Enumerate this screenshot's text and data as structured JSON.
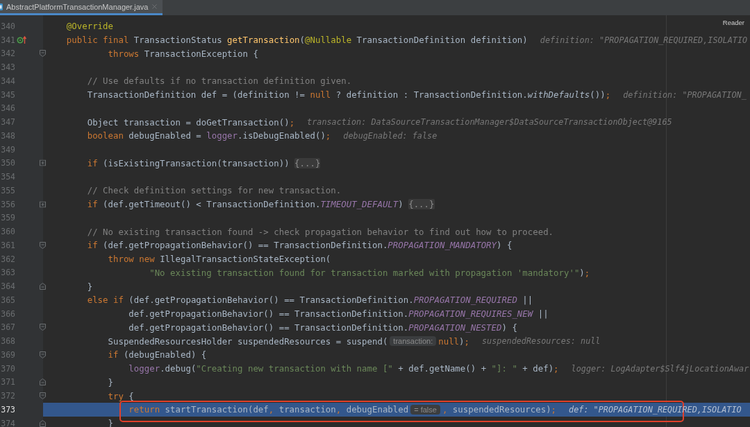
{
  "tabs": [
    {
      "label": "AbstractPlatformTransactionManager.java",
      "selected": true
    }
  ],
  "reader_mode": "Reader",
  "lines": [
    {
      "number": "340",
      "segments": [
        {
          "kind": "code",
          "tokens": [
            {
              "kind": "ann",
              "t": "    @Override"
            }
          ]
        }
      ]
    },
    {
      "number": "341",
      "gutter_icon": {
        "kind": "override"
      },
      "segments": [
        {
          "kind": "code",
          "tokens": [
            {
              "kind": "kw",
              "t": "    public final "
            },
            {
              "kind": "plain",
              "t": "TransactionStatus "
            },
            {
              "kind": "fn",
              "t": "getTransaction"
            },
            {
              "kind": "plain",
              "t": "("
            },
            {
              "kind": "ann",
              "t": "@Nullable"
            },
            {
              "kind": "plain",
              "t": " TransactionDefinition definition)"
            }
          ]
        },
        {
          "kind": "hint",
          "text": "definition: \"PROPAGATION_REQUIRED,ISOLATIO"
        }
      ]
    },
    {
      "number": "342",
      "fold_marker": {
        "kind": "open"
      },
      "segments": [
        {
          "kind": "code",
          "tokens": [
            {
              "kind": "kw",
              "t": "            throws "
            },
            {
              "kind": "plain",
              "t": "TransactionException {"
            }
          ]
        }
      ]
    },
    {
      "number": "343"
    },
    {
      "number": "344",
      "segments": [
        {
          "kind": "code",
          "tokens": [
            {
              "kind": "comment",
              "t": "        // Use defaults if no transaction definition given."
            }
          ]
        }
      ]
    },
    {
      "number": "345",
      "segments": [
        {
          "kind": "code",
          "tokens": [
            {
              "kind": "plain",
              "t": "        TransactionDefinition def = (definition != "
            },
            {
              "kind": "kw",
              "t": "null"
            },
            {
              "kind": "plain",
              "t": " ? definition : TransactionDefinition."
            },
            {
              "kind": "italic",
              "t": "withDefaults"
            },
            {
              "kind": "plain",
              "t": "())"
            },
            {
              "kind": "kw",
              "t": ";"
            }
          ]
        },
        {
          "kind": "hint",
          "text": "definition: \"PROPAGATION_"
        }
      ]
    },
    {
      "number": "346"
    },
    {
      "number": "347",
      "segments": [
        {
          "kind": "code",
          "tokens": [
            {
              "kind": "plain",
              "t": "        Object transaction = doGetTransaction()"
            },
            {
              "kind": "kw",
              "t": ";"
            }
          ]
        },
        {
          "kind": "hint",
          "text": "transaction: DataSourceTransactionManager$DataSourceTransactionObject@9165"
        }
      ]
    },
    {
      "number": "348",
      "segments": [
        {
          "kind": "code",
          "tokens": [
            {
              "kind": "kw",
              "t": "        boolean "
            },
            {
              "kind": "plain",
              "t": "debugEnabled = "
            },
            {
              "kind": "field",
              "t": "logger"
            },
            {
              "kind": "plain",
              "t": ".isDebugEnabled()"
            },
            {
              "kind": "kw",
              "t": ";"
            }
          ]
        },
        {
          "kind": "hint",
          "text": "debugEnabled: false"
        }
      ]
    },
    {
      "number": "349"
    },
    {
      "number": "350",
      "fold_marker": {
        "kind": "collapsed"
      },
      "segments": [
        {
          "kind": "code",
          "tokens": [
            {
              "kind": "kw",
              "t": "        if "
            },
            {
              "kind": "plain",
              "t": "(isExistingTransaction(transaction)) "
            }
          ]
        },
        {
          "kind": "fold",
          "text": "{...}"
        }
      ]
    },
    {
      "number": "354"
    },
    {
      "number": "355",
      "segments": [
        {
          "kind": "code",
          "tokens": [
            {
              "kind": "comment",
              "t": "        // Check definition settings for new transaction."
            }
          ]
        }
      ]
    },
    {
      "number": "356",
      "fold_marker": {
        "kind": "collapsed"
      },
      "segments": [
        {
          "kind": "code",
          "tokens": [
            {
              "kind": "kw",
              "t": "        if "
            },
            {
              "kind": "plain",
              "t": "(def.getTimeout() < TransactionDefinition."
            },
            {
              "kind": "const",
              "t": "TIMEOUT_DEFAULT"
            },
            {
              "kind": "plain",
              "t": ") "
            }
          ]
        },
        {
          "kind": "fold",
          "text": "{...}"
        }
      ]
    },
    {
      "number": "359"
    },
    {
      "number": "360",
      "segments": [
        {
          "kind": "code",
          "tokens": [
            {
              "kind": "comment",
              "t": "        // No existing transaction found -> check propagation behavior to find out how to proceed."
            }
          ]
        }
      ]
    },
    {
      "number": "361",
      "fold_marker": {
        "kind": "open"
      },
      "segments": [
        {
          "kind": "code",
          "tokens": [
            {
              "kind": "kw",
              "t": "        if "
            },
            {
              "kind": "plain",
              "t": "(def.getPropagationBehavior() == TransactionDefinition."
            },
            {
              "kind": "const",
              "t": "PROPAGATION_MANDATORY"
            },
            {
              "kind": "plain",
              "t": ") {"
            }
          ]
        }
      ]
    },
    {
      "number": "362",
      "segments": [
        {
          "kind": "code",
          "tokens": [
            {
              "kind": "kw",
              "t": "            throw new "
            },
            {
              "kind": "plain",
              "t": "IllegalTransactionStateException("
            }
          ]
        }
      ]
    },
    {
      "number": "363",
      "segments": [
        {
          "kind": "code",
          "tokens": [
            {
              "kind": "str",
              "t": "                    \"No existing transaction found for transaction marked with propagation 'mandatory'\""
            },
            {
              "kind": "plain",
              "t": ")"
            },
            {
              "kind": "kw",
              "t": ";"
            }
          ]
        }
      ]
    },
    {
      "number": "364",
      "fold_marker": {
        "kind": "close"
      },
      "segments": [
        {
          "kind": "code",
          "tokens": [
            {
              "kind": "plain",
              "t": "        }"
            }
          ]
        }
      ]
    },
    {
      "number": "365",
      "segments": [
        {
          "kind": "code",
          "tokens": [
            {
              "kind": "kw",
              "t": "        else if "
            },
            {
              "kind": "plain",
              "t": "(def.getPropagationBehavior() == TransactionDefinition."
            },
            {
              "kind": "const",
              "t": "PROPAGATION_REQUIRED"
            },
            {
              "kind": "plain",
              "t": " ||"
            }
          ]
        }
      ]
    },
    {
      "number": "366",
      "segments": [
        {
          "kind": "code",
          "tokens": [
            {
              "kind": "plain",
              "t": "                def.getPropagationBehavior() == TransactionDefinition."
            },
            {
              "kind": "const",
              "t": "PROPAGATION_REQUIRES_NEW"
            },
            {
              "kind": "plain",
              "t": " ||"
            }
          ]
        }
      ]
    },
    {
      "number": "367",
      "fold_marker": {
        "kind": "open"
      },
      "segments": [
        {
          "kind": "code",
          "tokens": [
            {
              "kind": "plain",
              "t": "                def.getPropagationBehavior() == TransactionDefinition."
            },
            {
              "kind": "const",
              "t": "PROPAGATION_NESTED"
            },
            {
              "kind": "plain",
              "t": ") {"
            }
          ]
        }
      ]
    },
    {
      "number": "368",
      "segments": [
        {
          "kind": "code",
          "tokens": [
            {
              "kind": "plain",
              "t": "            SuspendedResourcesHolder suspendedResources = suspend("
            }
          ]
        },
        {
          "kind": "param_hint",
          "text": "transaction:"
        },
        {
          "kind": "code",
          "tokens": [
            {
              "kind": "kw",
              "t": "null"
            },
            {
              "kind": "plain",
              "t": ")"
            },
            {
              "kind": "kw",
              "t": ";"
            }
          ]
        },
        {
          "kind": "hint",
          "text": "suspendedResources: null"
        }
      ]
    },
    {
      "number": "369",
      "fold_marker": {
        "kind": "open"
      },
      "segments": [
        {
          "kind": "code",
          "tokens": [
            {
              "kind": "kw",
              "t": "            if "
            },
            {
              "kind": "plain",
              "t": "(debugEnabled) {"
            }
          ]
        }
      ]
    },
    {
      "number": "370",
      "segments": [
        {
          "kind": "code",
          "tokens": [
            {
              "kind": "field",
              "t": "                logger"
            },
            {
              "kind": "plain",
              "t": ".debug("
            },
            {
              "kind": "str",
              "t": "\"Creating new transaction with name [\""
            },
            {
              "kind": "plain",
              "t": " + def.getName() + "
            },
            {
              "kind": "str",
              "t": "\"]: \""
            },
            {
              "kind": "plain",
              "t": " + def)"
            },
            {
              "kind": "kw",
              "t": ";"
            }
          ]
        },
        {
          "kind": "hint",
          "text": "logger: LogAdapter$Slf4jLocationAwar"
        }
      ]
    },
    {
      "number": "371",
      "fold_marker": {
        "kind": "close"
      },
      "segments": [
        {
          "kind": "code",
          "tokens": [
            {
              "kind": "plain",
              "t": "            }"
            }
          ]
        }
      ]
    },
    {
      "number": "372",
      "fold_marker": {
        "kind": "open"
      },
      "segments": [
        {
          "kind": "code",
          "tokens": [
            {
              "kind": "kw",
              "t": "            try "
            },
            {
              "kind": "plain",
              "t": "{"
            }
          ]
        }
      ]
    },
    {
      "number": "373",
      "current": true,
      "boxed": true,
      "segments": [
        {
          "kind": "code",
          "tokens": [
            {
              "kind": "kw",
              "t": "                return "
            },
            {
              "kind": "plain",
              "t": "startTransaction(def"
            },
            {
              "kind": "kw",
              "t": ", "
            },
            {
              "kind": "plain",
              "t": "transaction"
            },
            {
              "kind": "kw",
              "t": ", "
            },
            {
              "kind": "plain",
              "t": "debugEnabled"
            }
          ]
        },
        {
          "kind": "param_hint",
          "text": "= false"
        },
        {
          "kind": "code",
          "tokens": [
            {
              "kind": "kw",
              "t": ", "
            },
            {
              "kind": "plain",
              "t": "suspendedResources)"
            },
            {
              "kind": "kw",
              "t": ";"
            }
          ]
        },
        {
          "kind": "hint",
          "text": "def: \"PROPAGATION_REQUIRED,ISOLATIO"
        }
      ]
    },
    {
      "number": "374",
      "fold_marker": {
        "kind": "close"
      },
      "segments": [
        {
          "kind": "code",
          "tokens": [
            {
              "kind": "plain",
              "t": "            }"
            }
          ]
        }
      ]
    }
  ]
}
